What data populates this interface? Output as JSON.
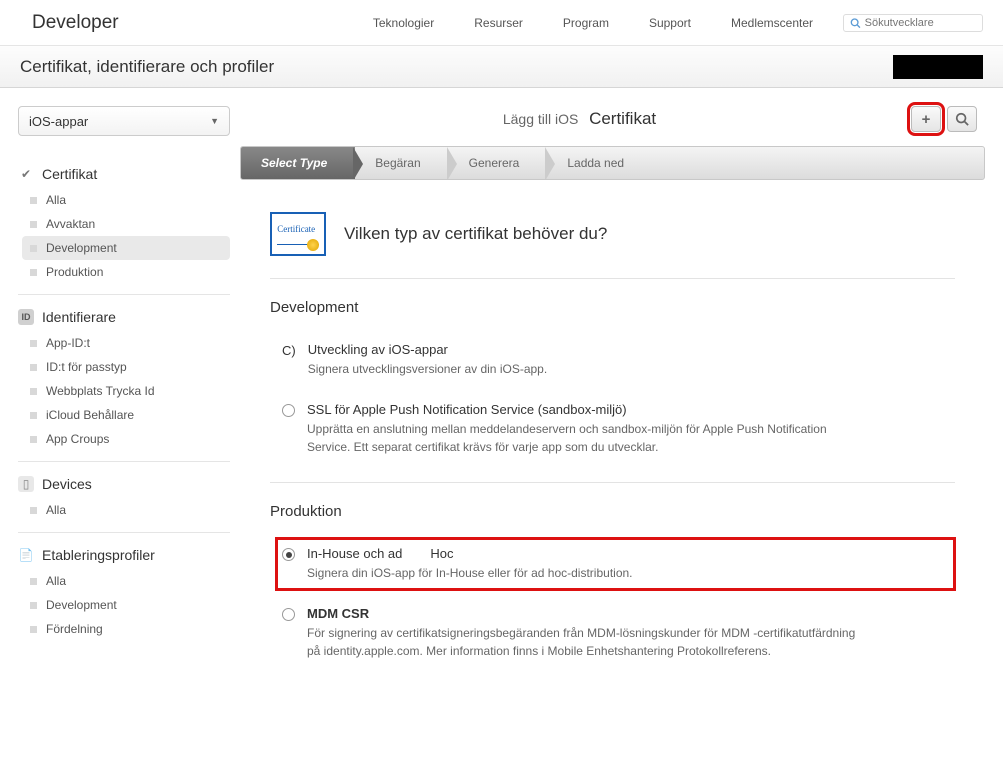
{
  "header": {
    "developer": "Developer",
    "nav": [
      "Teknologier",
      "Resurser",
      "Program",
      "Support",
      "Medlemscenter"
    ],
    "search_placeholder": "Sökutvecklare"
  },
  "subtitle": "Certifikat, identifierare och profiler",
  "sidebar": {
    "dropdown": "iOS-appar",
    "sections": [
      {
        "title": "Certifikat",
        "icon": "check",
        "items": [
          "Alla",
          "Avvaktan",
          "Development",
          "Produktion"
        ],
        "active_index": 2
      },
      {
        "title": "Identifierare",
        "icon": "id",
        "items": [
          "App-ID:t",
          "ID:t för passtyp",
          "Webbplats Trycka Id",
          "iCloud Behållare",
          "App Croups"
        ]
      },
      {
        "title": "Devices",
        "icon": "device",
        "items": [
          "Alla"
        ]
      },
      {
        "title": "Etableringsprofiler",
        "icon": "doc",
        "items": [
          "Alla",
          "Development",
          "Fördelning"
        ]
      }
    ]
  },
  "content": {
    "title_prefix": "Lägg till iOS",
    "title": "Certifikat",
    "wizard": [
      "Select Type",
      "Begäran",
      "Generera",
      "Ladda ned"
    ],
    "heading": "Vilken typ av certifikat behöver du?",
    "cert_icon_label": "Certificate",
    "sections": [
      {
        "title": "Development",
        "options": [
          {
            "prefix": "C)",
            "title": "Utveckling av iOS-appar",
            "desc": "Signera utvecklingsversioner av din iOS-app.",
            "selected": false,
            "radio": false
          },
          {
            "title": "SSL för Apple Push Notification Service (sandbox-miljö)",
            "desc": "Upprätta en anslutning mellan meddelandeservern och sandbox-miljön för Apple Push Notification Service. Ett separat certifikat krävs för varje app som du utvecklar.",
            "selected": false,
            "radio": true
          }
        ]
      },
      {
        "title": "Produktion",
        "options": [
          {
            "title_parts": [
              "In-House och ad",
              "Hoc"
            ],
            "desc": "Signera din iOS-app för In-House eller för ad hoc-distribution.",
            "selected": true,
            "radio": true,
            "highlight": true
          },
          {
            "title": "MDM CSR",
            "bold": true,
            "desc": "För signering av certifikatsigneringsbegäranden från MDM-lösningskunder för MDM -certifikatutfärdning på identity.apple.com. Mer information finns i Mobile Enhetshantering Protokollreferens.",
            "selected": false,
            "radio": true
          }
        ]
      }
    ]
  }
}
